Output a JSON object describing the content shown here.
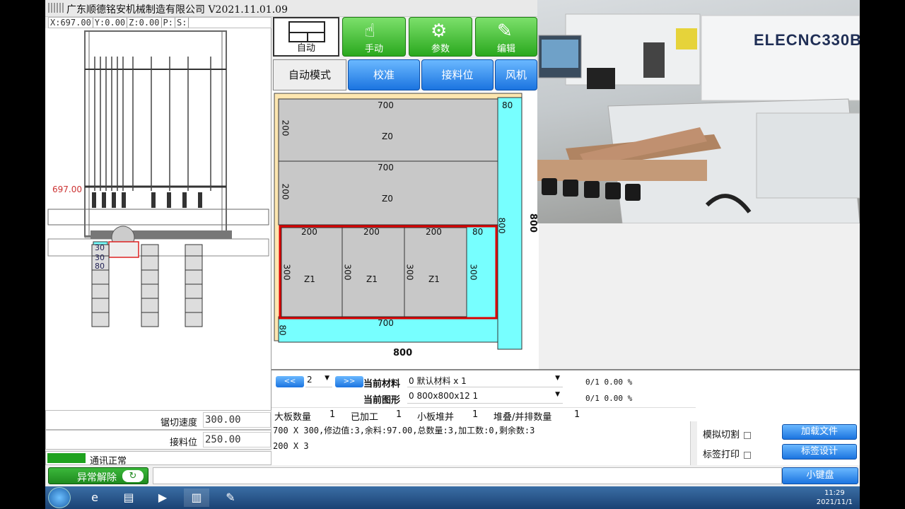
{
  "window": {
    "title": "广东顺德铭安机械制造有限公司 V2021.11.01.09"
  },
  "coords": {
    "x": "X:697.00",
    "y": "Y:0.00",
    "z": "Z:0.00",
    "p": "P:",
    "s": "S:"
  },
  "machine": {
    "position_marker": "697.00",
    "stack_labels": [
      "30",
      "30",
      "80"
    ]
  },
  "params": {
    "saw_speed_label": "锯切速度",
    "saw_speed_value": "300.00",
    "feed_pos_label": "接料位",
    "feed_pos_value": "250.00"
  },
  "comm_status": "通讯正常",
  "buttons": {
    "reset": "异常解除",
    "keyboard": "小键盘",
    "load_file": "加载文件",
    "label_design": "标签设计"
  },
  "top_buttons": [
    {
      "label": "自动",
      "icon": "layout-grid-icon"
    },
    {
      "label": "手动",
      "icon": "hand-icon"
    },
    {
      "label": "参数",
      "icon": "gear-house-icon"
    },
    {
      "label": "编辑",
      "icon": "edit-icon"
    }
  ],
  "tabs": [
    "自动模式",
    "校准",
    "接料位",
    "风机"
  ],
  "layout": {
    "width_label": "800",
    "height_label": "800",
    "strips": [
      {
        "w": "700",
        "h": "200",
        "name": "Z0"
      },
      {
        "w": "700",
        "h": "200",
        "name": "Z0"
      }
    ],
    "pieces": [
      {
        "w": "200",
        "h": "300",
        "name": "Z1"
      },
      {
        "w": "200",
        "h": "300",
        "name": "Z1"
      },
      {
        "w": "200",
        "h": "300",
        "name": "Z1"
      }
    ],
    "trim_right_w": "80",
    "trim_right_h": "300",
    "offcut_right_w": "80",
    "offcut_right_h": "800",
    "offcut_bottom_h": "80",
    "offcut_bottom_w": "700"
  },
  "photo": {
    "brand_text": "ELECNC330B"
  },
  "bottom": {
    "page_value": "2",
    "prev_label": "<<",
    "next_label": ">>",
    "material_label": "当前材料",
    "material_value": "0 默认材料 x 1",
    "material_progress": "0/1 0.00 %",
    "shape_label": "当前图形",
    "shape_value": "0 800x800x12 1",
    "shape_progress": "0/1 0.00 %",
    "big_board_label": "大板数量",
    "big_board_value": "1",
    "processed_label": "已加工",
    "processed_value": "1",
    "small_stack_label": "小板堆并",
    "small_stack_value": "1",
    "stack_count_label": "堆叠/并排数量",
    "stack_count_value": "1",
    "messages": [
      "700 X 300,修边值:3,余料:97.00,总数量:3,加工数:0,剩余数:3",
      "200 X 3"
    ],
    "sim_cut_label": "模拟切割",
    "label_print_label": "标签打印"
  },
  "taskbar": {
    "time": "11:29",
    "date": "2021/11/1"
  }
}
